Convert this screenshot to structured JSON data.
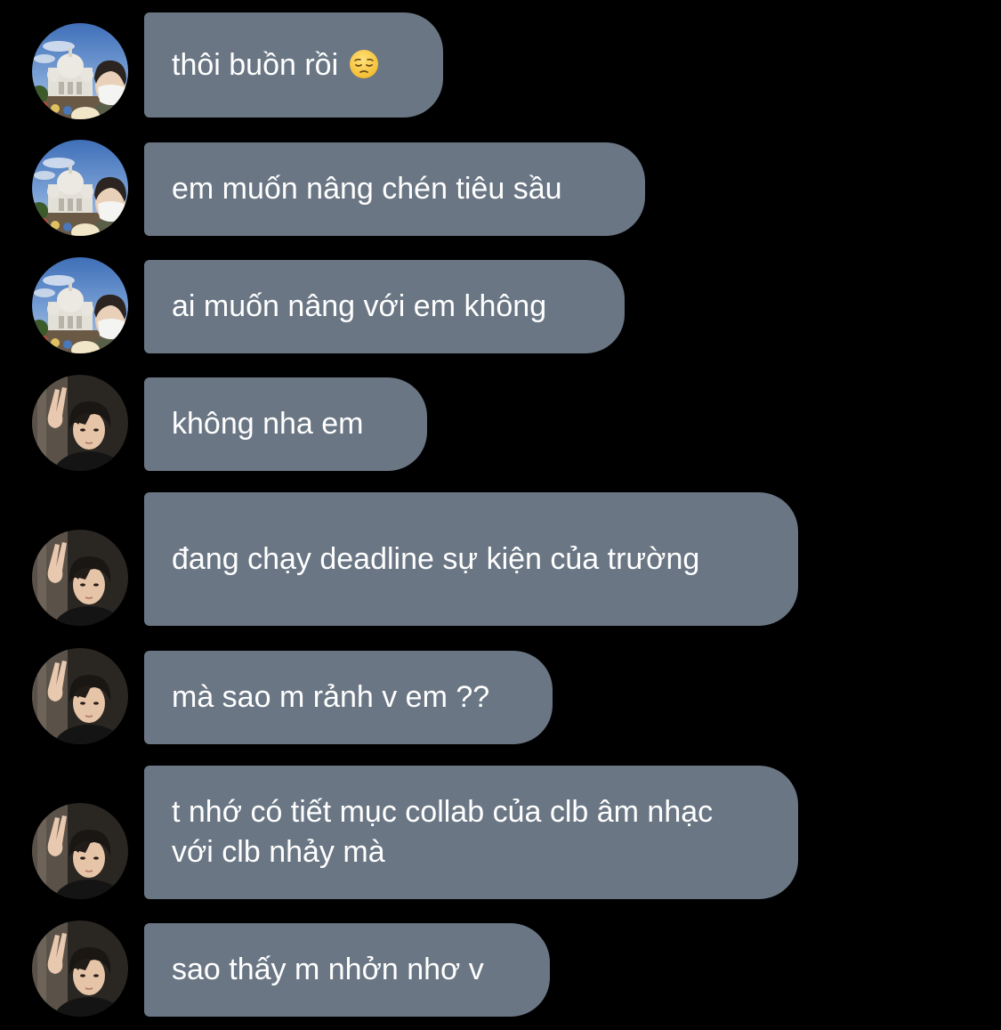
{
  "chat": {
    "messages": [
      {
        "sender": "user_a",
        "text": "thôi buồn rồi",
        "emoji": "pensive-face-emoji"
      },
      {
        "sender": "user_a",
        "text": "em muốn nâng chén tiêu sầu"
      },
      {
        "sender": "user_a",
        "text": "ai muốn nâng với em không"
      },
      {
        "sender": "user_b",
        "text": "không nha em"
      },
      {
        "sender": "user_b",
        "text": "đang chạy deadline sự kiện của trường"
      },
      {
        "sender": "user_b",
        "text": "mà sao m rảnh v em ??"
      },
      {
        "sender": "user_b",
        "text": "t nhớ có tiết mục collab của clb âm nhạc với clb nhảy mà"
      },
      {
        "sender": "user_b",
        "text": "sao thấy m nhởn nhơ v"
      }
    ]
  },
  "colors": {
    "background": "#000000",
    "bubble": "#6a7684",
    "text": "#ffffff"
  }
}
